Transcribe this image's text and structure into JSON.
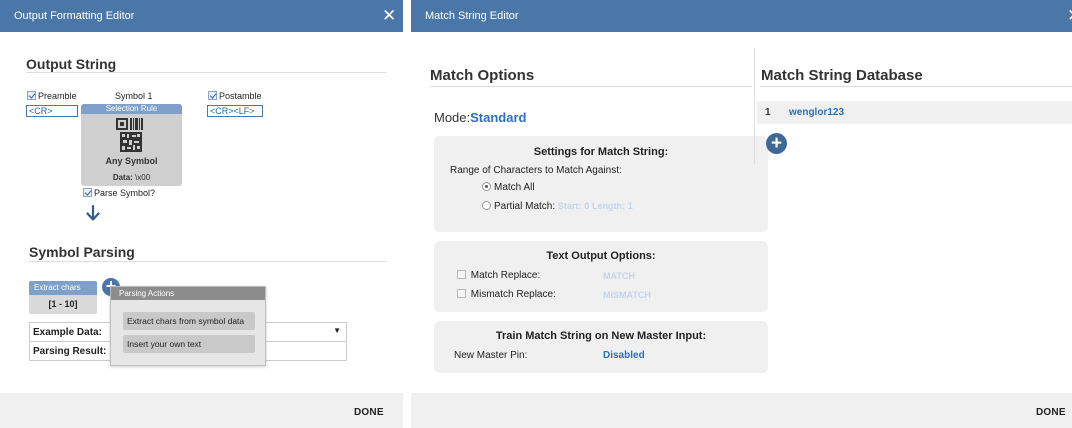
{
  "left": {
    "title": "Output Formatting Editor",
    "close_glyph": "✕",
    "output_string_heading": "Output String",
    "preamble_label": "Preamble",
    "preamble_value": "<CR>",
    "symbol_label": "Symbol 1",
    "postamble_label": "Postamble",
    "postamble_value": "<CR><LF>",
    "selection_rule_label": "Selection Rule",
    "any_symbol_label": "Any Symbol",
    "data_prefix": "Data:",
    "data_value": "\\x00",
    "parse_symbol_label": "Parse Symbol?",
    "symbol_parsing_heading": "Symbol Parsing",
    "extract_chip_label": "Extract chars",
    "extract_chip_range": "[1 - 10]",
    "example_data_label": "Example Data:",
    "parsing_result_label": "Parsing Result:",
    "parsing_actions_title": "Parsing Actions",
    "parsing_actions": [
      "Extract chars from symbol data",
      "Insert your own text"
    ],
    "done_label": "DONE"
  },
  "right": {
    "title": "Match String Editor",
    "close_glyph": "✕",
    "match_options_heading": "Match Options",
    "mode_label": "Mode:",
    "mode_value": "Standard",
    "settings_title": "Settings for Match String:",
    "range_label": "Range of Characters to Match Against:",
    "match_all_label": "Match All",
    "partial_match_label": "Partial Match:",
    "start_label": "Start:",
    "start_value": "0",
    "length_label": "Length:",
    "length_value": "1",
    "text_output_title": "Text Output Options:",
    "match_replace_label": "Match Replace:",
    "match_replace_value": "MATCH",
    "mismatch_replace_label": "Mismatch Replace:",
    "mismatch_replace_value": "MISMATCH",
    "train_title": "Train Match String on New Master Input:",
    "new_master_pin_label": "New Master Pin:",
    "new_master_pin_value": "Disabled",
    "database_heading": "Match String Database",
    "database_rows": [
      {
        "index": "1",
        "value": "wenglor123"
      }
    ],
    "done_label": "DONE"
  },
  "colors": {
    "titlebar": "#4a77a8",
    "accent_text": "#2b5f9e",
    "footer": "#f0f0f0",
    "chip_header": "#7fa1c9",
    "faint_value": "#c4d4ea"
  }
}
